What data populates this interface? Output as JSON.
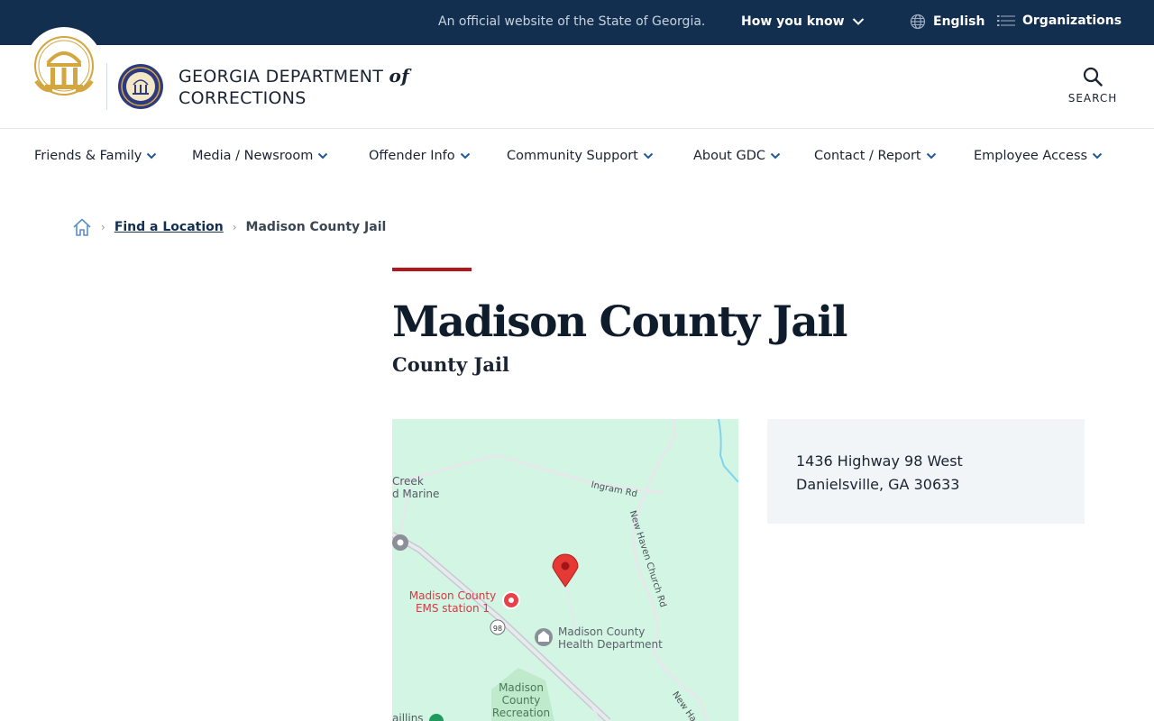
{
  "gov_banner": {
    "official_text": "An official website of the State of Georgia.",
    "how_you_know": "How you know",
    "language": "English",
    "organizations": "Organizations"
  },
  "header": {
    "org_name_line1": "GEORGIA DEPARTMENT",
    "org_name_of": "of",
    "org_name_line2": "CORRECTIONS",
    "search_label": "SEARCH"
  },
  "nav": {
    "items": [
      {
        "label": "Friends & Family"
      },
      {
        "label": "Media / Newsroom"
      },
      {
        "label": "Offender Info"
      },
      {
        "label": "Community Support"
      },
      {
        "label": "About GDC"
      },
      {
        "label": "Contact / Report"
      },
      {
        "label": "Employee Access"
      }
    ]
  },
  "breadcrumb": {
    "link": "Find a Location",
    "current": "Madison County Jail"
  },
  "page": {
    "title": "Madison County Jail",
    "subtitle": "County Jail"
  },
  "map": {
    "labels": {
      "creek": "Creek",
      "marine": "d Marine",
      "ingram": "Ingram Rd",
      "new_haven": "New Haven Church Rd",
      "new_haven_2": "New Ha",
      "ems_1": "Madison County",
      "ems_2": "EMS station 1",
      "health_1": "Madison County",
      "health_2": "Health Department",
      "route": "98",
      "rec_1": "Madison",
      "rec_2": "County",
      "rec_3": "Recreation",
      "partial": "aillins"
    }
  },
  "address": {
    "line1": "1436 Highway 98 West",
    "line2": "Danielsville, GA 30633"
  },
  "colors": {
    "banner_bg": "#132f4f",
    "accent_red": "#b3171b",
    "map_bg": "#d3f5e3",
    "card_bg": "#f2f5f8",
    "pin_red": "#e53935"
  }
}
